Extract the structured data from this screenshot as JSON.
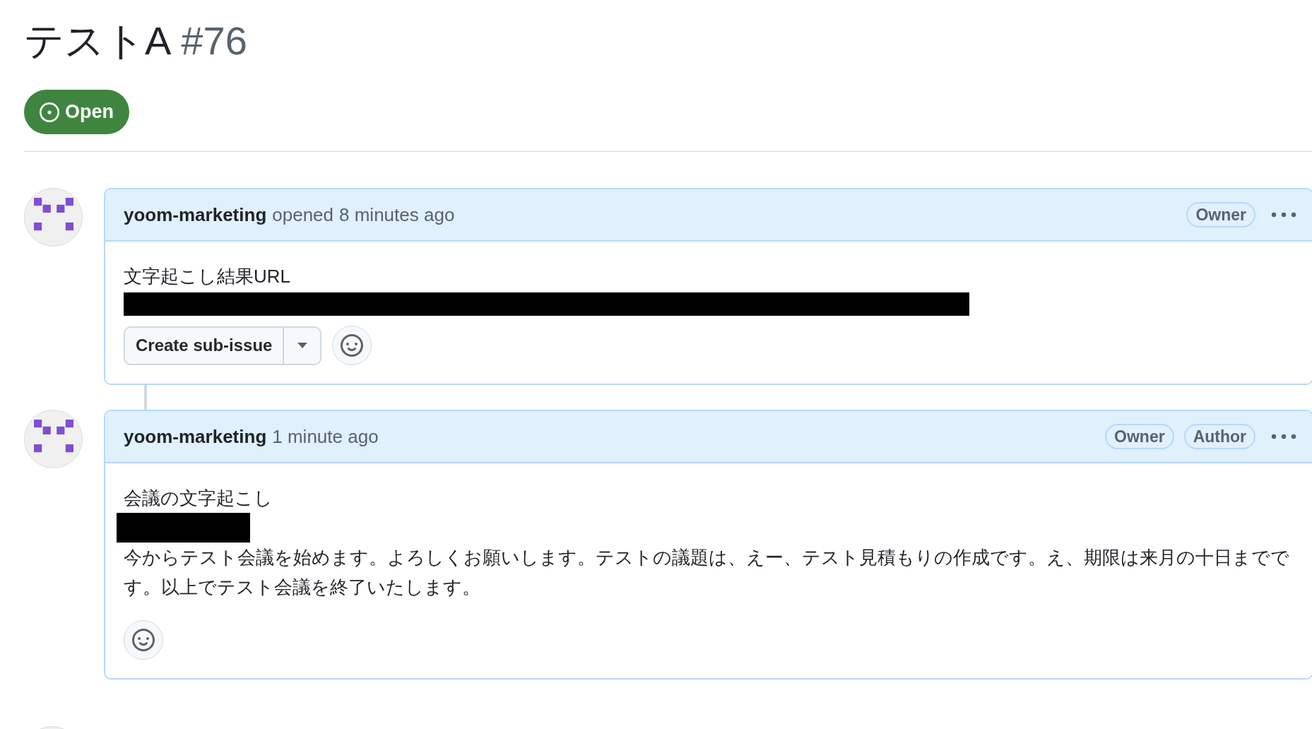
{
  "issue": {
    "title": "テストA",
    "number": "#76",
    "state": {
      "kind": "open",
      "label": "Open"
    }
  },
  "comments": [
    {
      "author": "yoom-marketing",
      "action": "opened",
      "time": "8 minutes ago",
      "badges": [
        "Owner"
      ],
      "body": [
        {
          "kind": "text",
          "text": "文字起こし結果URL"
        },
        {
          "kind": "redacted_line"
        }
      ],
      "sub_issue_button": "Create sub-issue"
    },
    {
      "author": "yoom-marketing",
      "time": "1 minute ago",
      "badges": [
        "Owner",
        "Author"
      ],
      "body": [
        {
          "kind": "text",
          "text": "会議の文字起こし"
        },
        {
          "kind": "redacted_word"
        },
        {
          "kind": "text",
          "text": "今からテスト会議を始めます。よろしくお願いします。テストの議題は、えー、テスト見積もりの作成です。え、期限は来月の十日までです。以上でテスト会議を終了いたします。"
        }
      ]
    },
    {
      "kind": "cut_off"
    }
  ]
}
